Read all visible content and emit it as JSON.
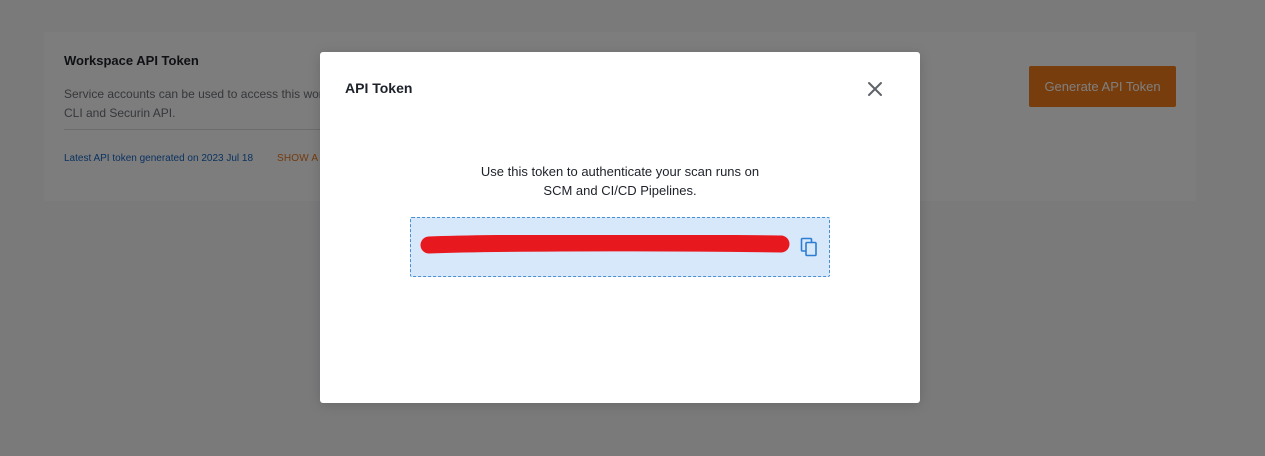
{
  "background_page": {
    "card": {
      "title": "Workspace API Token",
      "description": "Service accounts can be used to access this works\nCLI and Securin API.",
      "latest_token_text": "Latest API token generated on 2023 Jul 18",
      "show_link_label": "SHOW A"
    },
    "generate_button_label": "Generate API Token"
  },
  "modal": {
    "title": "API Token",
    "message_line1": "Use this token to authenticate your scan runs on",
    "message_line2": "SCM and CI/CD Pipelines.",
    "token": {
      "redacted": true
    },
    "icons": {
      "close": "close-icon",
      "copy": "copy-icon"
    }
  },
  "colors": {
    "accent_orange": "#f07a1a",
    "link_blue": "#1565c0",
    "token_box_bg": "#d7e8fb",
    "token_box_border": "#4a8fd6",
    "redaction": "#e8191e",
    "copy_icon": "#2d7dd2",
    "overlay": "rgba(0,0,0,0.5)"
  }
}
